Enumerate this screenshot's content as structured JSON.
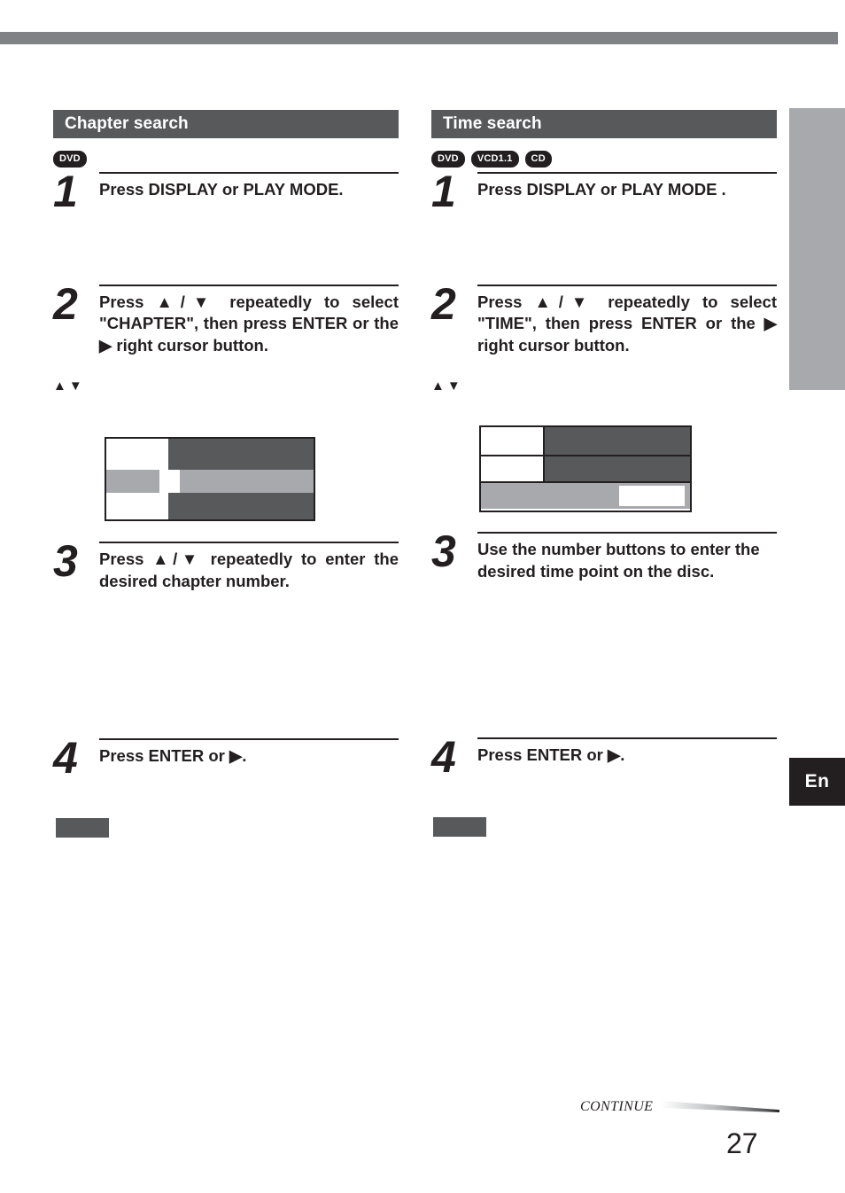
{
  "page": {
    "number": "27",
    "continue_label": "CONTINUE",
    "language_tab": "En"
  },
  "columns": [
    {
      "id": "chapter-search",
      "heading": "Chapter search",
      "badges": [
        "DVD"
      ],
      "steps": [
        {
          "num": "1",
          "text": "Press DISPLAY or PLAY MODE."
        },
        {
          "num": "2",
          "text": "Press ▲/▼ repeatedly to select \"CHAPTER\", then press ENTER or the ▶ right cursor button."
        },
        {
          "num": "3",
          "text": "Press ▲/▼ repeatedly to enter the desired chapter number."
        },
        {
          "num": "4",
          "text": "Press ENTER or ▶."
        }
      ],
      "updown_glyphs": "▲▼",
      "osd": {
        "rows": [
          {
            "left": "white",
            "right": "dark",
            "highlight": false
          },
          {
            "left": "light",
            "right": "light",
            "highlight": true
          },
          {
            "left": "white",
            "right": "dark",
            "highlight": false
          }
        ]
      }
    },
    {
      "id": "time-search",
      "heading": "Time search",
      "badges": [
        "DVD",
        "VCD1.1",
        "CD"
      ],
      "steps": [
        {
          "num": "1",
          "text": "Press DISPLAY or PLAY MODE ."
        },
        {
          "num": "2",
          "text": "Press ▲/▼ repeatedly to select \"TIME\", then press ENTER or the ▶ right cursor button."
        },
        {
          "num": "3",
          "text": "Use the number buttons to enter the desired time point on the disc."
        },
        {
          "num": "4",
          "text": "Press ENTER or ▶."
        }
      ],
      "updown_glyphs": "▲▼",
      "osd": {
        "rows": [
          {
            "left": "white",
            "right": "dark",
            "highlight": false
          },
          {
            "left": "white",
            "right": "dark",
            "highlight": false
          },
          {
            "left": "light",
            "right": "light",
            "highlight": true
          }
        ]
      }
    }
  ],
  "colors": {
    "heading_bar": "#58595b",
    "rule_bar": "#808285",
    "edge_block": "#a7a9ac",
    "edge_tab": "#231f20",
    "ink": "#231f20"
  }
}
